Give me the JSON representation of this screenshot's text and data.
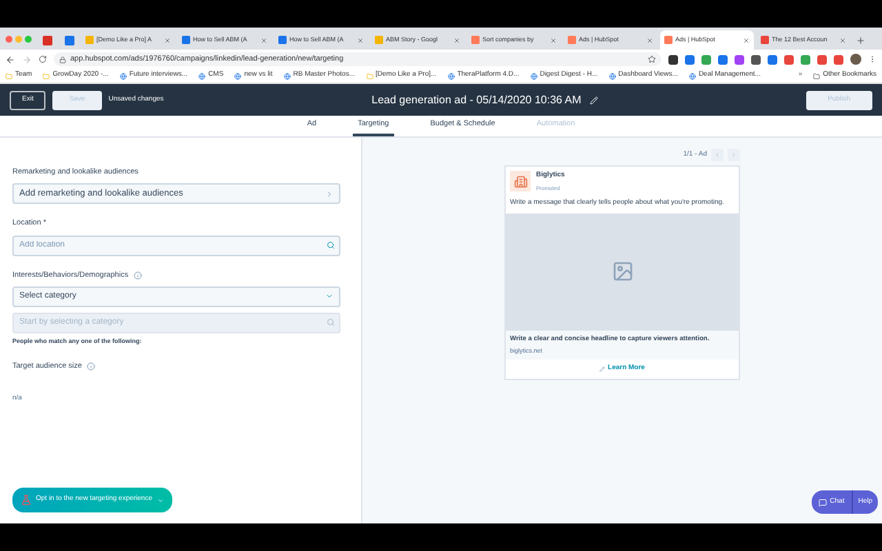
{
  "browser": {
    "tabs": [
      {
        "kind": "pinned",
        "selected": false,
        "color": "#d93025"
      },
      {
        "kind": "pinned",
        "selected": false,
        "color": "#1a73e8"
      },
      {
        "kind": "page",
        "title": "[Demo Like a Pro] A",
        "selected": false,
        "color": "#f4b400"
      },
      {
        "kind": "page",
        "title": "How to Sell ABM (A",
        "selected": false,
        "color": "#1a73e8"
      },
      {
        "kind": "page",
        "title": "How to Sell ABM (A",
        "selected": false,
        "color": "#1a73e8"
      },
      {
        "kind": "page",
        "title": "ABM Story - Googl",
        "selected": false,
        "color": "#f4b400"
      },
      {
        "kind": "page",
        "title": "Sort companies by",
        "selected": false,
        "color": "#ff7a59"
      },
      {
        "kind": "page",
        "title": "Ads | HubSpot",
        "selected": false,
        "color": "#ff7a59"
      },
      {
        "kind": "page",
        "title": "Ads | HubSpot",
        "selected": true,
        "color": "#ff7a59"
      },
      {
        "kind": "page",
        "title": "The 12 Best Accoun",
        "selected": false,
        "color": "#e8453c"
      }
    ],
    "url": "app.hubspot.com/ads/1976760/campaigns/linkedin/lead-generation/new/targeting",
    "bookmarks": [
      {
        "kind": "folder",
        "label": "Team"
      },
      {
        "kind": "folder",
        "label": "GrowDay 2020 -..."
      },
      {
        "kind": "page",
        "label": "Future interviews..."
      },
      {
        "kind": "page",
        "label": "CMS"
      },
      {
        "kind": "page",
        "label": "new vs lit"
      },
      {
        "kind": "page",
        "label": "RB Master Photos..."
      },
      {
        "kind": "folder",
        "label": "[Demo Like a Pro]..."
      },
      {
        "kind": "page",
        "label": "TheraPlatform 4.D..."
      },
      {
        "kind": "page",
        "label": "Digest Digest - H..."
      },
      {
        "kind": "page",
        "label": "Dashboard Views..."
      },
      {
        "kind": "page",
        "label": "Deal Management..."
      }
    ],
    "more": "»",
    "other_bookmarks": "Other Bookmarks"
  },
  "header": {
    "exit": "Exit",
    "save": "Save",
    "save_disabled": true,
    "status": "Unsaved changes",
    "title": "Lead generation ad - 05/14/2020 10:36 AM",
    "publish": "Publish",
    "publish_disabled": true
  },
  "tabs": [
    {
      "label": "Ad",
      "selected": false,
      "disabled": false
    },
    {
      "label": "Targeting",
      "selected": true,
      "disabled": false
    },
    {
      "label": "Budget & Schedule",
      "selected": false,
      "disabled": false
    },
    {
      "label": "Automation",
      "selected": false,
      "disabled": true
    }
  ],
  "form": [
    {
      "kind": "link",
      "label": "Remarketing and lookalike audiences",
      "value": "Add remarketing and lookalike audiences"
    },
    {
      "kind": "search",
      "label": "Location *",
      "placeholder": "Add location",
      "disabled": false
    },
    {
      "kind": "select",
      "label": "Interests/Behaviors/Demographics",
      "info": true,
      "value": "Select category"
    },
    {
      "kind": "search",
      "placeholder": "Start by selecting a category",
      "disabled": true,
      "note": "People who match any one of the following:"
    },
    {
      "kind": "readout",
      "label": "Target audience size",
      "info": true,
      "value": "n/a"
    }
  ],
  "preview": {
    "pager": "1/1 - Ad",
    "company": "Biglytics",
    "promoted": "Promoted",
    "message": "Write a message that clearly tells people about what you're promoting.",
    "headline": "Write a clear and concise headline to capture viewers attention.",
    "domain": "biglytics.net",
    "cta": "Learn More"
  },
  "opt_in": "Opt in to the new targeting experience",
  "chat": "Chat",
  "help": "Help"
}
